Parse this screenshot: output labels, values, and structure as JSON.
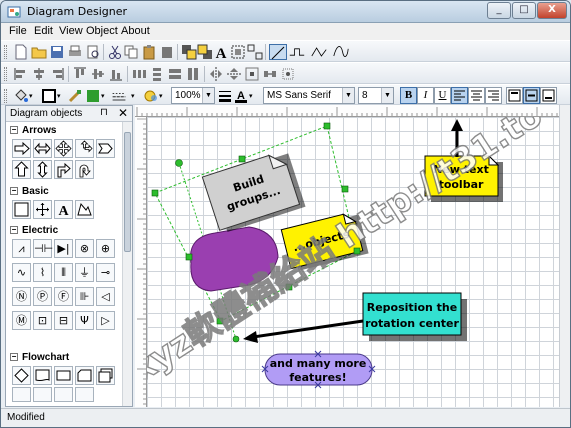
{
  "window": {
    "title": "Diagram Designer",
    "controls": [
      "_",
      "□",
      "X"
    ]
  },
  "menu": [
    "File",
    "Edit",
    "View",
    "Object",
    "About"
  ],
  "format_toolbar": {
    "zoom": "100%",
    "font_family": "MS Sans Serif",
    "font_size": "8",
    "bold": "B",
    "italic": "I",
    "underline": "U"
  },
  "panel": {
    "title": "Diagram objects",
    "pin": "⊓",
    "close": "✕",
    "sections": [
      {
        "name": "Arrows",
        "toggle": "−"
      },
      {
        "name": "Basic",
        "toggle": "−"
      },
      {
        "name": "Electric",
        "toggle": "−"
      },
      {
        "name": "Flowchart",
        "toggle": "−"
      }
    ],
    "basic_text_glyph": "A"
  },
  "canvas": {
    "note_build": "Build groups...",
    "note_build_lines": [
      "Build",
      "groups..."
    ],
    "note_objects": "...objects",
    "note_toolbar_lines": [
      "New text",
      "toolbar"
    ],
    "note_rotation_lines": [
      "Reposition the",
      "rotation center"
    ],
    "note_features_lines": [
      "and many more",
      "features!"
    ]
  },
  "watermark": "xyz軟體補給站 http://t31.to",
  "status": {
    "text": "Modified"
  },
  "colors": {
    "yellow_note": "#fff200",
    "cyan_note": "#33e0d0",
    "violet": "#b19cf5",
    "purple_oval": "#9a3fb0",
    "selection_green": "#2dbd2d"
  }
}
